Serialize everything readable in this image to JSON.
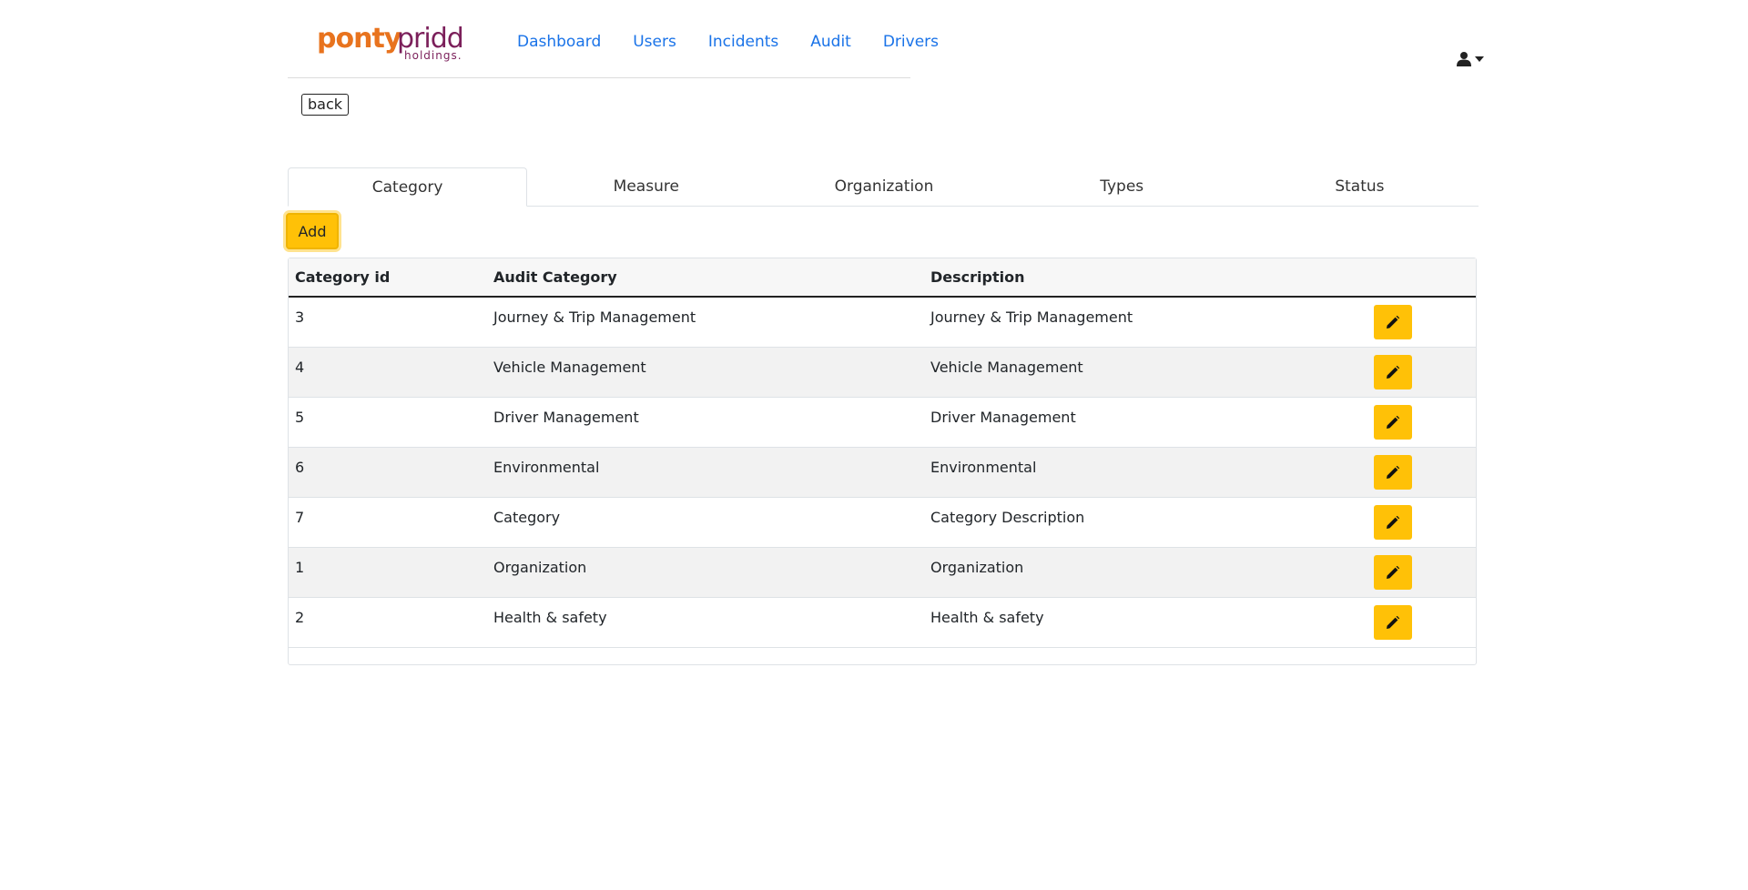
{
  "brand": {
    "logo_alt": "pontypridd holdings",
    "logo_word_1": "ponty",
    "logo_word_2": "pridd",
    "logo_sub": "holdings",
    "colors": {
      "orange": "#e8731e",
      "purple": "#7b1f5a"
    }
  },
  "nav": {
    "links": [
      {
        "label": "Dashboard"
      },
      {
        "label": "Users"
      },
      {
        "label": "Incidents"
      },
      {
        "label": "Audit"
      },
      {
        "label": "Drivers"
      }
    ]
  },
  "user_menu": {
    "icon": "user-icon"
  },
  "back_label": "back",
  "tabs": [
    {
      "label": "Category",
      "active": true
    },
    {
      "label": "Measure"
    },
    {
      "label": "Organization"
    },
    {
      "label": "Types"
    },
    {
      "label": "Status"
    }
  ],
  "add_label": "Add",
  "table": {
    "headers": [
      "Category id",
      "Audit Category",
      "Description",
      ""
    ],
    "rows": [
      {
        "id": "3",
        "category": "Journey & Trip Management",
        "description": "Journey & Trip Management"
      },
      {
        "id": "4",
        "category": "Vehicle Management",
        "description": "Vehicle Management"
      },
      {
        "id": "5",
        "category": "Driver Management",
        "description": "Driver Management"
      },
      {
        "id": "6",
        "category": "Environmental",
        "description": "Environmental"
      },
      {
        "id": "7",
        "category": "Category",
        "description": "Category Description"
      },
      {
        "id": "1",
        "category": "Organization",
        "description": "Organization"
      },
      {
        "id": "2",
        "category": "Health & safety",
        "description": "Health & safety"
      }
    ]
  },
  "accent_color": "#ffc107",
  "link_color": "#1a73e8"
}
